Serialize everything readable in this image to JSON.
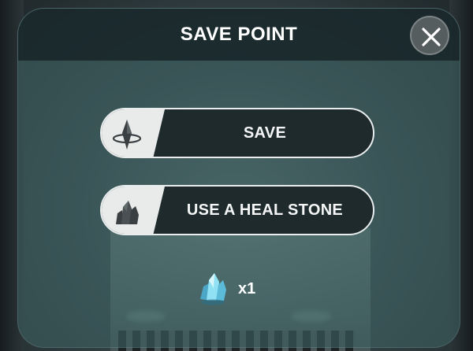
{
  "dialog": {
    "title": "SAVE POINT",
    "close_icon": "close-icon"
  },
  "actions": {
    "save": {
      "label": "SAVE",
      "icon": "save-crystal-icon"
    },
    "heal": {
      "label": "USE A HEAL STONE",
      "icon": "heal-stone-icon"
    }
  },
  "inventory": {
    "heal_stone_icon": "blue-crystal-icon",
    "quantity": "x1"
  },
  "colors": {
    "panel": "#3c5e60",
    "header": "#14202a",
    "button_bg": "#1f2a2d",
    "button_border": "#e9eded",
    "icon_wedge": "#e9ebeb",
    "text": "#ffffff",
    "crystal": "#7fd3ea"
  }
}
